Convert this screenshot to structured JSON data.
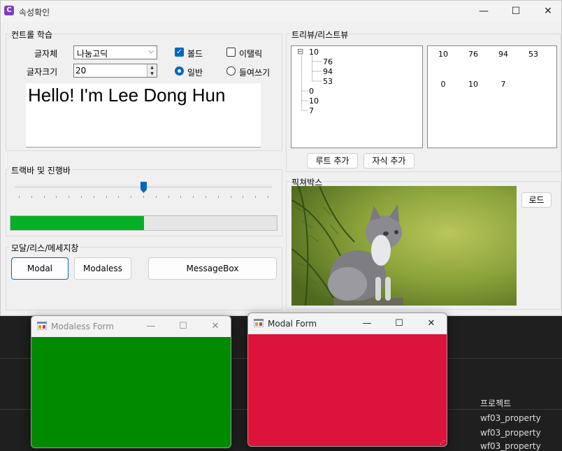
{
  "window": {
    "title": "속성확인",
    "minimize": "—",
    "maximize": "☐",
    "close": "✕"
  },
  "font_group": {
    "title": "컨트롤 학습",
    "font_label": "글자체",
    "font_value": "나눔고딕",
    "size_label": "글자크기",
    "size_value": "20",
    "bold_label": "볼드",
    "bold_checked": true,
    "italic_label": "이탤릭",
    "italic_checked": false,
    "normal_label": "일반",
    "normal_selected": true,
    "underline_label": "들여쓰기",
    "underline_selected": false,
    "sample_text": "Hello! I'm Lee Dong Hun"
  },
  "track_group": {
    "title": "트랙바 및 진행바",
    "trackbar_value": 10,
    "trackbar_max": 20,
    "progress_percent": 50
  },
  "dialog_group": {
    "title": "모달/리스/메세지창",
    "modal_button": "Modal",
    "modaless_button": "Modaless",
    "messagebox_button": "MessageBox"
  },
  "tree_group": {
    "title": "트리뷰/리스트뷰",
    "tree": {
      "expander": "⊟",
      "root": "10",
      "children": [
        "76",
        "94",
        "53"
      ],
      "siblings": [
        "0",
        "10",
        "7"
      ]
    },
    "list_rows": [
      [
        "10",
        "76",
        "94",
        "53"
      ],
      [
        "0",
        "10",
        "7"
      ]
    ],
    "add_root_button": "루트 추가",
    "add_child_button": "자식 추가"
  },
  "picture_group": {
    "title": "픽쳐박스",
    "load_button": "로드",
    "image": "kitten-photo"
  },
  "modaless_form": {
    "title": "Modaless Form",
    "background": "#008a00"
  },
  "modal_form": {
    "title": "Modal Form",
    "background": "#dc143c"
  },
  "ide": {
    "panel_title": "프로젝트",
    "items": [
      "wf03_property",
      "wf03_property",
      "wf03_property"
    ]
  },
  "colors": {
    "accent": "#0067c0",
    "progress": "#06b025"
  }
}
